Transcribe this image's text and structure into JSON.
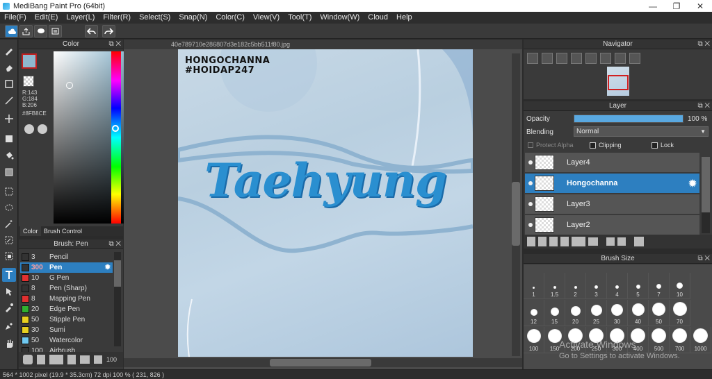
{
  "window": {
    "title": "MediBang Paint Pro (64bit)"
  },
  "menu": [
    "File(F)",
    "Edit(E)",
    "Layer(L)",
    "Filter(R)",
    "Select(S)",
    "Snap(N)",
    "Color(C)",
    "View(V)",
    "Tool(T)",
    "Window(W)",
    "Cloud",
    "Help"
  ],
  "colors": {
    "accent": "#2d7fc0",
    "primary": "#8FB8CE",
    "panel_bg": "#3a3a3a"
  },
  "color_panel": {
    "title": "Color",
    "r": "R:143",
    "g": "G:184",
    "b": "B:206",
    "hex": "#8FB8CE",
    "tabs": [
      "Color",
      "Brush Control"
    ]
  },
  "brush_panel": {
    "title": "Brush: Pen",
    "brushes": [
      {
        "size": "3",
        "name": "Pencil",
        "color": "#333333"
      },
      {
        "size": "300",
        "name": "Pen",
        "color": "#333333",
        "selected": true
      },
      {
        "size": "10",
        "name": "G Pen",
        "color": "#e03030"
      },
      {
        "size": "8",
        "name": "Pen (Sharp)",
        "color": "#333333"
      },
      {
        "size": "8",
        "name": "Mapping Pen",
        "color": "#e03030"
      },
      {
        "size": "20",
        "name": "Edge Pen",
        "color": "#30b030"
      },
      {
        "size": "50",
        "name": "Stipple Pen",
        "color": "#e8d020"
      },
      {
        "size": "30",
        "name": "Sumi",
        "color": "#e8d020"
      },
      {
        "size": "50",
        "name": "Watercolor",
        "color": "#6fc8f0"
      },
      {
        "size": "100",
        "name": "Airbrush",
        "color": "#333333"
      }
    ]
  },
  "canvas": {
    "tab_name": "40e789710e286807d3e182c5bb511f80.jpg",
    "caption_line1": "HONGOCHANNA",
    "caption_line2": "#HOIDAP247",
    "art_text": "Taehyung"
  },
  "navigator": {
    "title": "Navigator"
  },
  "layer_panel": {
    "title": "Layer",
    "opacity_label": "Opacity",
    "opacity_value": "100 %",
    "opacity_fraction": 1.0,
    "blending_label": "Blending",
    "blending_value": "Normal",
    "protect_alpha": "Protect Alpha",
    "clipping": "Clipping",
    "lock": "Lock",
    "layers": [
      {
        "name": "Layer4",
        "selected": false
      },
      {
        "name": "Hongochanna",
        "selected": true
      },
      {
        "name": "Layer3",
        "selected": false
      },
      {
        "name": "Layer2",
        "selected": false
      }
    ]
  },
  "brush_size_panel": {
    "title": "Brush Size",
    "rows": [
      [
        "1",
        "1.5",
        "2",
        "3",
        "4",
        "5",
        "7",
        "10"
      ],
      [
        "12",
        "15",
        "20",
        "25",
        "30",
        "40",
        "50",
        "70"
      ],
      [
        "100",
        "150",
        "200",
        "250",
        "300",
        "400",
        "500",
        "700",
        "1000"
      ]
    ]
  },
  "status": {
    "text": "564 * 1002 pixel  (19.9 * 35.3cm)  72 dpi  100 %  ( 231, 826 )"
  },
  "watermark": {
    "line1": "Activate Windows",
    "line2": "Go to Settings to activate Windows."
  }
}
